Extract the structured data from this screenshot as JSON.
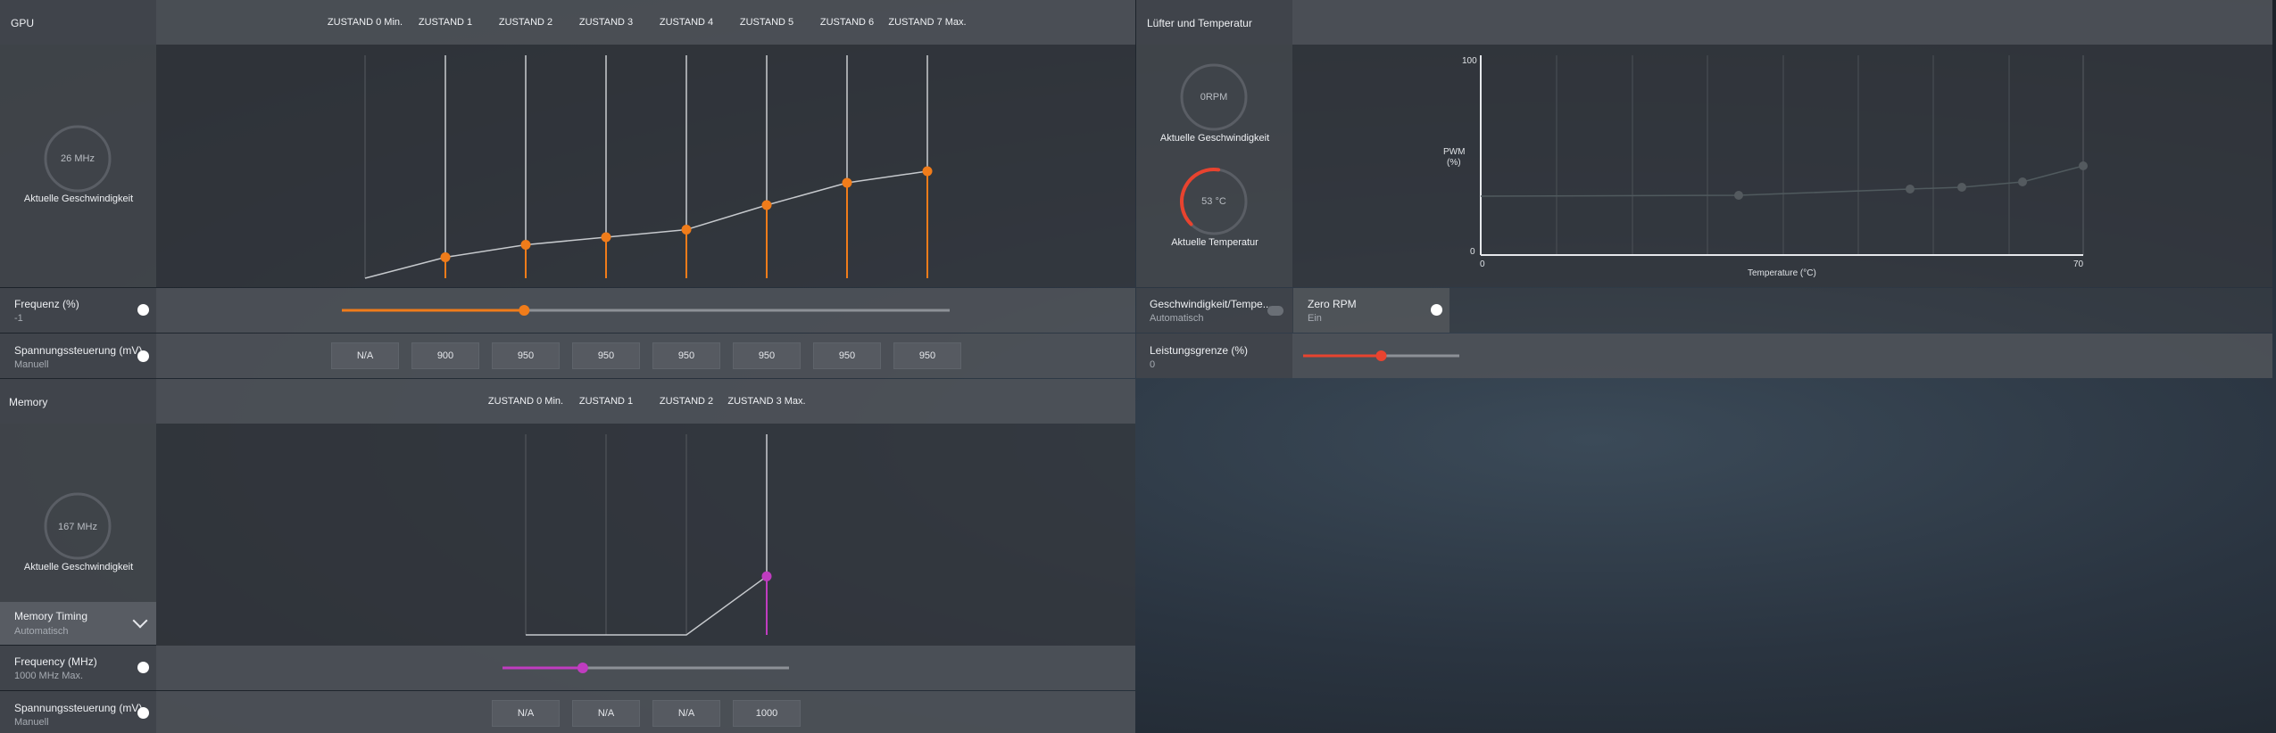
{
  "gpu": {
    "title": "GPU",
    "states": [
      "ZUSTAND 0 Min.",
      "ZUSTAND 1",
      "ZUSTAND 2",
      "ZUSTAND 3",
      "ZUSTAND 4",
      "ZUSTAND 5",
      "ZUSTAND 6",
      "ZUSTAND 7 Max."
    ],
    "gauge": {
      "value": "26 MHz",
      "label": "Aktuelle Geschwindigkeit"
    },
    "curve_levels": [
      0.0,
      0.094,
      0.15,
      0.184,
      0.218,
      0.328,
      0.428,
      0.48
    ],
    "frequency": {
      "label": "Frequenz (%)",
      "value": "-1",
      "slider_fraction": 0.3
    },
    "voltage": {
      "label": "Spannungssteuerung (mV)",
      "mode": "Manuell",
      "values": [
        "N/A",
        "900",
        "950",
        "950",
        "950",
        "950",
        "950",
        "950"
      ]
    },
    "accent": "#f07c1a"
  },
  "memory": {
    "title": "Memory",
    "states": [
      "ZUSTAND 0 Min.",
      "ZUSTAND 1",
      "ZUSTAND 2",
      "ZUSTAND 3 Max."
    ],
    "gauge": {
      "value": "167 MHz",
      "label": "Aktuelle Geschwindigkeit"
    },
    "curve_levels": [
      0.0,
      0.0,
      0.0,
      0.292
    ],
    "timing": {
      "label": "Memory Timing",
      "value": "Automatisch"
    },
    "frequency": {
      "label": "Frequency (MHz)",
      "value": "1000 MHz Max.",
      "slider_fraction": 0.28
    },
    "voltage": {
      "label": "Spannungssteuerung (mV)",
      "mode": "Manuell",
      "values": [
        "N/A",
        "N/A",
        "N/A",
        "1000"
      ]
    },
    "accent": "#c03cc0"
  },
  "fan": {
    "title": "Lüfter und Temperatur",
    "speed_gauge": {
      "value": "0RPM",
      "label": "Aktuelle Geschwindigkeit"
    },
    "temp_gauge": {
      "value": "53 °C",
      "label": "Aktuelle Temperatur",
      "fraction": 0.53
    },
    "chart": {
      "ylabel_line1": "PWM",
      "ylabel_line2": "(%)",
      "y_max": "100",
      "y_min": "0",
      "x_min": "0",
      "x_max": "70",
      "xlabel": "Temperature (°C)"
    },
    "mode": {
      "label": "Geschwindigkeit/Tempe...",
      "value": "Automatisch"
    },
    "zero_rpm": {
      "label": "Zero RPM",
      "value": "Ein"
    },
    "power_limit": {
      "label": "Leistungsgrenze (%)",
      "value": "0",
      "slider_fraction": 0.5
    },
    "accent": "#e8432f"
  }
}
